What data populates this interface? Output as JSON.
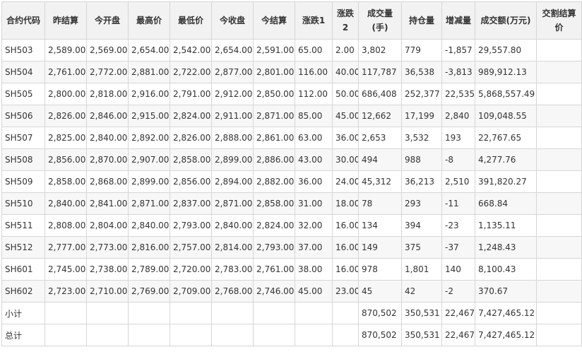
{
  "headers": [
    "合约代码",
    "昨结算",
    "今开盘",
    "最高价",
    "最低价",
    "今收盘",
    "今结算",
    "涨跌1",
    "涨跌2",
    "成交量(手)",
    "持仓量",
    "增减量",
    "成交额(万元)",
    "交割结算价"
  ],
  "rows": [
    [
      "SH503",
      "2,589.00",
      "2,569.00",
      "2,654.00",
      "2,542.00",
      "2,654.00",
      "2,591.00",
      "65.00",
      "2.00",
      "3,802",
      "779",
      "-1,857",
      "29,557.80",
      ""
    ],
    [
      "SH504",
      "2,761.00",
      "2,772.00",
      "2,881.00",
      "2,722.00",
      "2,877.00",
      "2,801.00",
      "116.00",
      "40.00",
      "117,787",
      "36,538",
      "-3,813",
      "989,912.13",
      ""
    ],
    [
      "SH505",
      "2,800.00",
      "2,818.00",
      "2,916.00",
      "2,791.00",
      "2,912.00",
      "2,850.00",
      "112.00",
      "50.00",
      "686,408",
      "252,377",
      "22,535",
      "5,868,557.49",
      ""
    ],
    [
      "SH506",
      "2,826.00",
      "2,846.00",
      "2,915.00",
      "2,824.00",
      "2,911.00",
      "2,871.00",
      "85.00",
      "45.00",
      "12,662",
      "17,199",
      "2,840",
      "109,048.55",
      ""
    ],
    [
      "SH507",
      "2,825.00",
      "2,840.00",
      "2,892.00",
      "2,826.00",
      "2,888.00",
      "2,861.00",
      "63.00",
      "36.00",
      "2,653",
      "3,532",
      "193",
      "22,767.65",
      ""
    ],
    [
      "SH508",
      "2,856.00",
      "2,870.00",
      "2,907.00",
      "2,858.00",
      "2,899.00",
      "2,886.00",
      "43.00",
      "30.00",
      "494",
      "988",
      "-8",
      "4,277.76",
      ""
    ],
    [
      "SH509",
      "2,858.00",
      "2,868.00",
      "2,899.00",
      "2,856.00",
      "2,894.00",
      "2,882.00",
      "36.00",
      "24.00",
      "45,312",
      "36,213",
      "2,510",
      "391,820.27",
      ""
    ],
    [
      "SH510",
      "2,840.00",
      "2,841.00",
      "2,871.00",
      "2,837.00",
      "2,871.00",
      "2,858.00",
      "31.00",
      "18.00",
      "78",
      "293",
      "-11",
      "668.84",
      ""
    ],
    [
      "SH511",
      "2,808.00",
      "2,804.00",
      "2,840.00",
      "2,793.00",
      "2,840.00",
      "2,824.00",
      "32.00",
      "16.00",
      "134",
      "394",
      "-23",
      "1,135.11",
      ""
    ],
    [
      "SH512",
      "2,777.00",
      "2,773.00",
      "2,816.00",
      "2,757.00",
      "2,814.00",
      "2,793.00",
      "37.00",
      "16.00",
      "149",
      "375",
      "-37",
      "1,248.43",
      ""
    ],
    [
      "SH601",
      "2,745.00",
      "2,738.00",
      "2,789.00",
      "2,720.00",
      "2,783.00",
      "2,761.00",
      "38.00",
      "16.00",
      "978",
      "1,801",
      "140",
      "8,100.43",
      ""
    ],
    [
      "SH602",
      "2,723.00",
      "2,710.00",
      "2,769.00",
      "2,709.00",
      "2,768.00",
      "2,746.00",
      "45.00",
      "23.00",
      "45",
      "42",
      "-2",
      "370.67",
      ""
    ]
  ],
  "totals": [
    [
      "小计",
      "",
      "",
      "",
      "",
      "",
      "",
      "",
      "",
      "870,502",
      "350,531",
      "22,467",
      "7,427,465.12",
      ""
    ],
    [
      "总计",
      "",
      "",
      "",
      "",
      "",
      "",
      "",
      "",
      "870,502",
      "350,531",
      "22,467",
      "7,427,465.12",
      ""
    ]
  ]
}
